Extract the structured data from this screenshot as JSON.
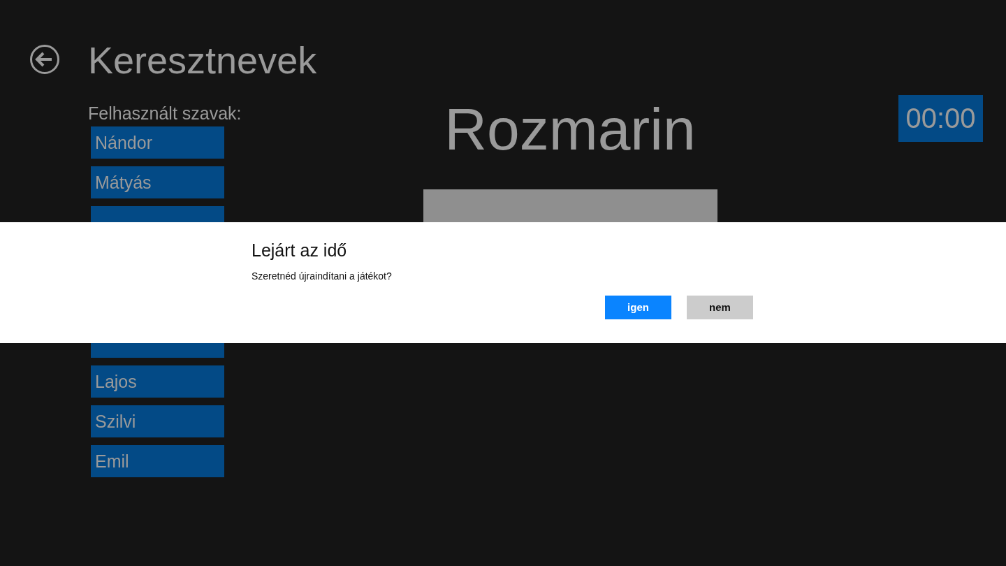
{
  "page": {
    "title": "Keresztnevek",
    "used_words_label": "Felhasznált szavak:"
  },
  "used_words_top": [
    {
      "kind": "word",
      "text": "Nándor"
    },
    {
      "kind": "word",
      "text": "Mátyás"
    },
    {
      "kind": "covered"
    }
  ],
  "used_words_bottom": [
    {
      "kind": "covered"
    },
    {
      "kind": "word",
      "text": "Lajos"
    },
    {
      "kind": "word",
      "text": "Szilvi"
    },
    {
      "kind": "word",
      "text": "Emil"
    }
  ],
  "current_word": "Rozmarin",
  "timer": "00:00",
  "dialog": {
    "title": "Lejárt az idő",
    "message": "Szeretnéd újraindítani a játékot?",
    "buttons": [
      {
        "label": "igen",
        "primary": true
      },
      {
        "label": "nem",
        "primary": false
      }
    ]
  }
}
